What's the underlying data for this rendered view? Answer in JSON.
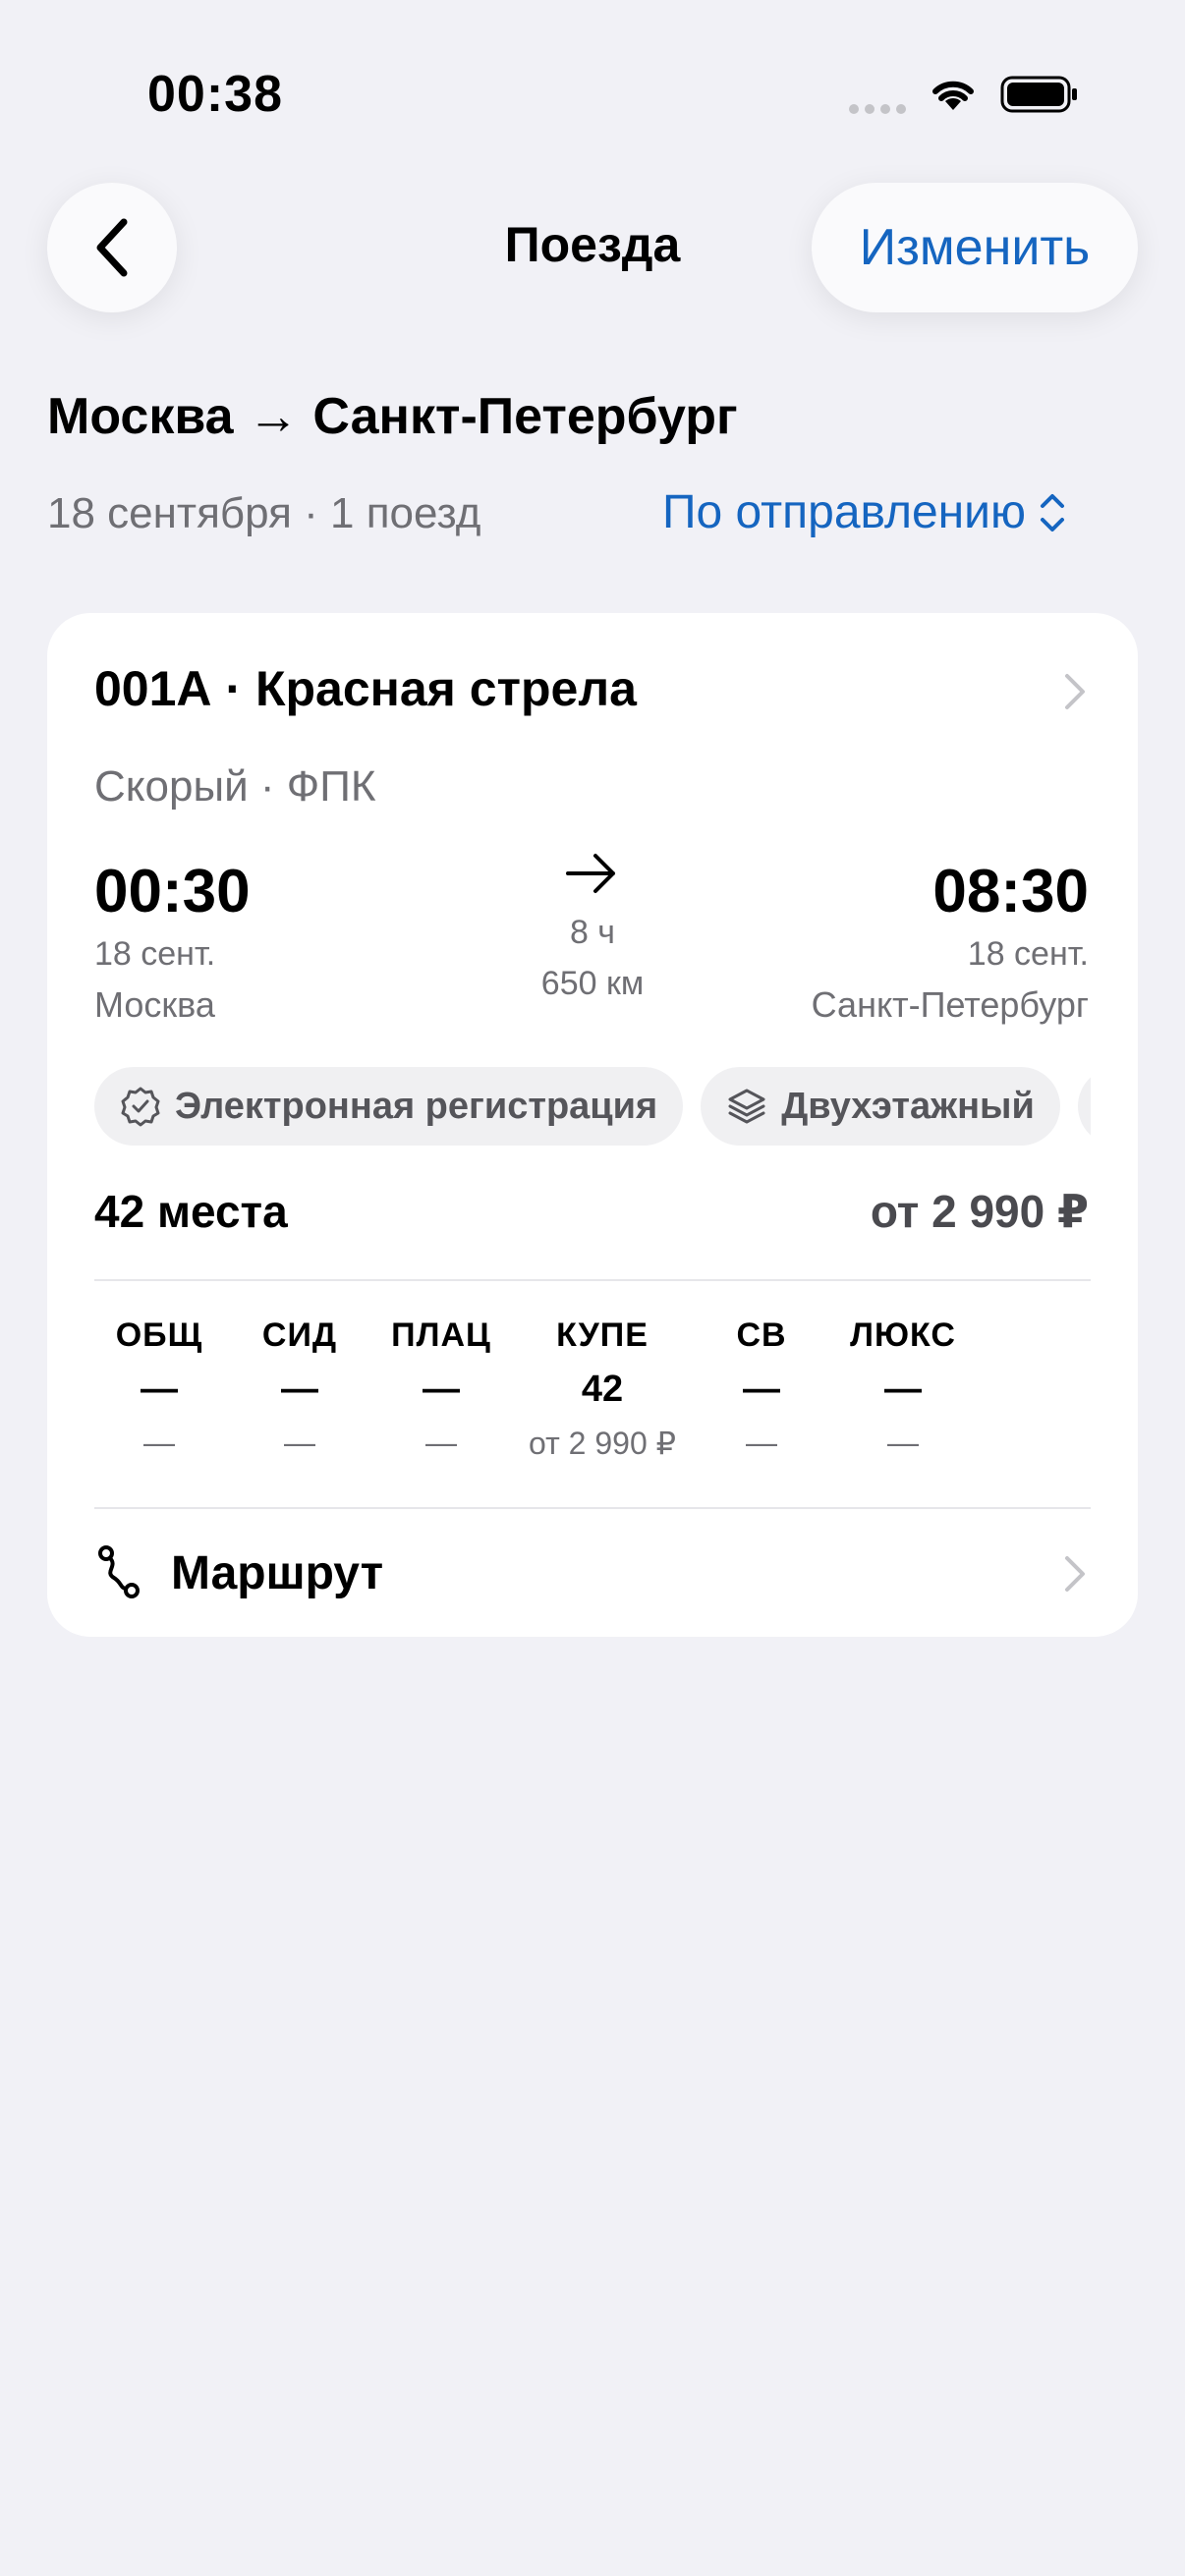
{
  "status_bar": {
    "time": "00:38"
  },
  "nav": {
    "title": "Поезда",
    "edit_label": "Изменить"
  },
  "route_title": "Москва → Санкт-Петербург",
  "subtitle": "18 сентября · 1 поезд",
  "sort_label": "По отправлению",
  "train": {
    "name": "001А · Красная стрела",
    "type": "Скорый · ФПК",
    "departure": {
      "time": "00:30",
      "date": "18 сент.",
      "city": "Москва"
    },
    "arrival": {
      "time": "08:30",
      "date": "18 сент.",
      "city": "Санкт-Петербург"
    },
    "duration": "8 ч",
    "distance": "650 км",
    "features": [
      {
        "label": "Электронная регистрация",
        "icon": "verified-badge-icon"
      },
      {
        "label": "Двухэтажный",
        "icon": "layers-icon"
      }
    ],
    "seats": "42 места",
    "price": "от 2 990 ₽",
    "classes": [
      {
        "name": "ОБЩ",
        "count": "—",
        "price": "—"
      },
      {
        "name": "СИД",
        "count": "—",
        "price": "—"
      },
      {
        "name": "ПЛАЦ",
        "count": "—",
        "price": "—"
      },
      {
        "name": "КУПЕ",
        "count": "42",
        "price": "от 2 990 ₽"
      },
      {
        "name": "СВ",
        "count": "—",
        "price": "—"
      },
      {
        "name": "ЛЮКС",
        "count": "—",
        "price": "—"
      }
    ],
    "route_label": "Маршрут"
  },
  "colors": {
    "accent": "#1565c0",
    "background": "#f1f1f6",
    "card": "#ffffff",
    "secondary_text": "#6f6f74"
  }
}
